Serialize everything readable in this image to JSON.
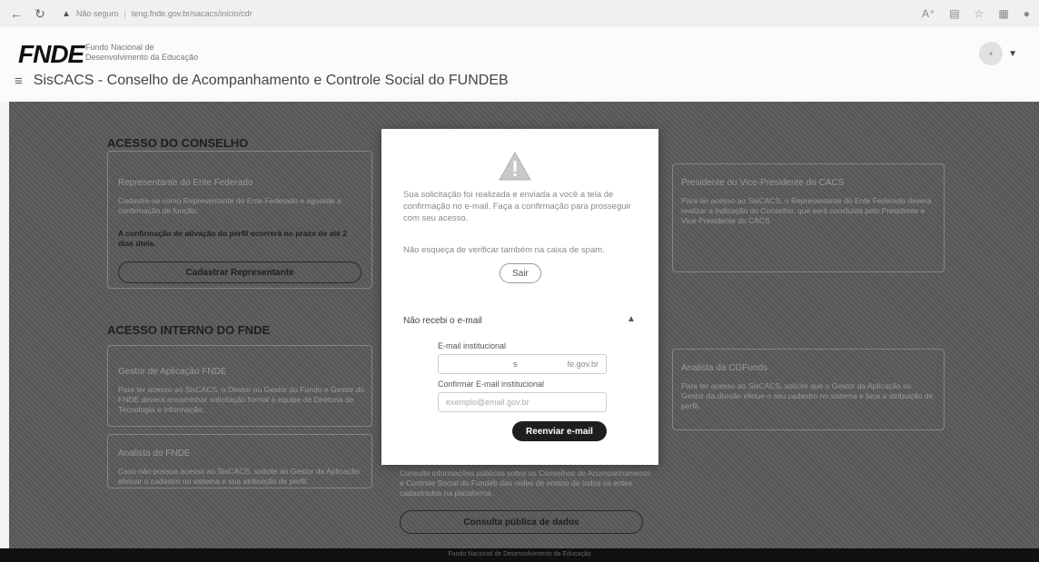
{
  "browser": {
    "security": "Não seguro",
    "url": "teng.fnde.gov.br/sacacs/inicio/cdr"
  },
  "header": {
    "logo": "FNDE",
    "logo_sub_1": "Fundo Nacional de",
    "logo_sub_2": "Desenvolvimento da Educação",
    "system_title": "SisCACS - Conselho de Acompanhamento e Controle Social do FUNDEB"
  },
  "acesso_conselho": {
    "title": "ACESSO DO CONSELHO",
    "card_title": "Representante do Ente Federado",
    "card_text": "Cadastre-se como Representante do Ente Federado e aguarde a confirmação de função.",
    "bold_text": "A confirmação de ativação do perfil ocorrerá no prazo de até 2 dias úteis.",
    "button": "Cadastrar Representante"
  },
  "acesso_interno": {
    "title": "ACESSO INTERNO DO FNDE",
    "card1_title": "Gestor de Aplicação FNDE",
    "card1_text": "Para ter acesso ao SisCACS, o Diretor ou Gestor do Fundo e Gestor do FNDE deverá encaminhar solicitação formal à equipe da Diretoria de Tecnologia e Informação.",
    "card2_title": "Analista do FNDE",
    "card2_text": "Caso não possua acesso ao SisCACS, solicite ao Gestor da Aplicação efetuar o cadastro no sistema e sua atribuição de perfil."
  },
  "right_cards": {
    "card1_title": "Presidente ou Vice-Presidente do CACS",
    "card1_text": "Para ter acesso ao SisCACS, o Representante do Ente Federado deverá realizar a indicação do Conselho, que será concluída pelo Presidente e Vice-Presidente do CACS.",
    "card2_title": "Analista da CGFunds",
    "card2_text": "Para ter acesso ao SisCACS, solicite que o Gestor da Aplicação ou Gestor da divisão efetue o seu cadastro no sistema e faça a atribuição de perfil."
  },
  "consulta": {
    "text": "Consulte informações públicas sobre os Conselhos de Acompanhamento e Controle Social do Fundeb das redes de ensino de todos os entes cadastrados na plataforma.",
    "button": "Consulta pública de dados"
  },
  "modal": {
    "message": "Sua solicitação foi realizada e enviada a você a tela de confirmação no e-mail. Faça a confirmação para prosseguir com seu acesso.",
    "spam_note": "Não esqueça de verificar também na caixa de spam.",
    "sair": "Sair",
    "accordion_title": "Não recebi o e-mail",
    "email_label": "E-mail institucional",
    "email_value": "s",
    "email_suffix": "fe.gov.br",
    "confirm_label": "Confirmar E-mail institucional",
    "confirm_placeholder": "exemplo@email.gov.br",
    "resend_button": "Reenviar e-mail"
  },
  "footer": {
    "text": "Fundo Nacional de Desenvolvimento da Educação"
  }
}
